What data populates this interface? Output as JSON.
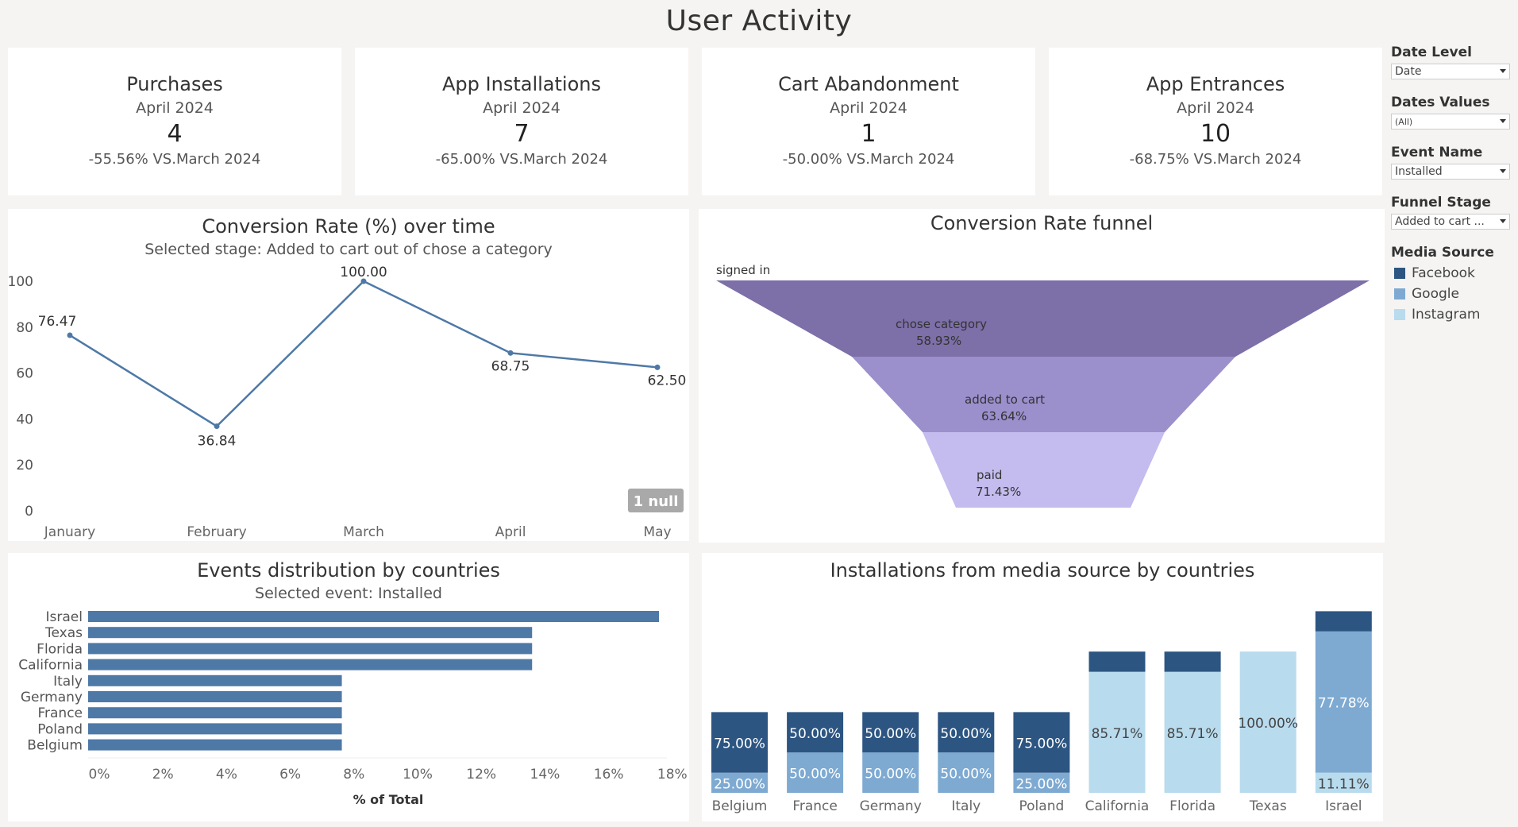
{
  "page_title": "User Activity",
  "kpis": [
    {
      "name": "Purchases",
      "period": "April 2024",
      "value": "4",
      "delta": "-55.56% VS.March 2024"
    },
    {
      "name": "App Installations",
      "period": "April 2024",
      "value": "7",
      "delta": "-65.00% VS.March 2024"
    },
    {
      "name": "Cart Abandonment",
      "period": "April 2024",
      "value": "1",
      "delta": "-50.00% VS.March 2024"
    },
    {
      "name": "App Entrances",
      "period": "April 2024",
      "value": "10",
      "delta": "-68.75% VS.March 2024"
    }
  ],
  "filters": {
    "date_level": {
      "label": "Date Level",
      "value": "Date"
    },
    "dates_values": {
      "label": "Dates Values",
      "value": "(All)"
    },
    "event_name": {
      "label": "Event Name",
      "value": "Installed"
    },
    "funnel_stage": {
      "label": "Funnel Stage",
      "value": "Added to cart ..."
    }
  },
  "legend": {
    "title": "Media Source",
    "items": [
      {
        "name": "Facebook",
        "color": "#2c5582"
      },
      {
        "name": "Google",
        "color": "#7eaad2"
      },
      {
        "name": "Instagram",
        "color": "#b8dbee"
      }
    ]
  },
  "chart_data": [
    {
      "type": "line",
      "title": "Conversion Rate (%) over time",
      "subtitle": "Selected stage: Added to cart out of chose a category",
      "categories": [
        "January",
        "February",
        "March",
        "April",
        "May"
      ],
      "values": [
        76.47,
        36.84,
        100.0,
        68.75,
        62.5
      ],
      "data_labels": [
        "76.47",
        "36.84",
        "100.00",
        "68.75",
        "62.50"
      ],
      "ylim": [
        0,
        100
      ],
      "yticks": [
        0,
        20,
        40,
        60,
        80,
        100
      ],
      "color": "#4e79a7",
      "null_badge": "1 null"
    },
    {
      "type": "funnel",
      "title": "Conversion Rate funnel",
      "stages": [
        {
          "name": "signed in",
          "pct": "",
          "color": "#7d6fa8"
        },
        {
          "name": "chose category",
          "pct": "58.93%",
          "color": "#9b8fcc"
        },
        {
          "name": "added to cart",
          "pct": "63.64%",
          "color": "#c4bbee"
        },
        {
          "name": "paid",
          "pct": "71.43%",
          "color": "#c4bbee"
        }
      ]
    },
    {
      "type": "bar",
      "orientation": "horizontal",
      "title": "Events distribution by countries",
      "subtitle": "Selected event:  Installed",
      "categories": [
        "Israel",
        "Texas",
        "Florida",
        "California",
        "Italy",
        "Germany",
        "France",
        "Poland",
        "Belgium"
      ],
      "values": [
        18,
        14,
        14,
        14,
        8,
        8,
        8,
        8,
        8
      ],
      "xlim": [
        0,
        18
      ],
      "xticks": [
        "0%",
        "2%",
        "4%",
        "6%",
        "8%",
        "10%",
        "12%",
        "14%",
        "16%",
        "18%"
      ],
      "xlabel": "% of Total",
      "color": "#4e79a7"
    },
    {
      "type": "bar",
      "orientation": "stacked",
      "title": "Installations from media source by countries",
      "categories": [
        "Belgium",
        "France",
        "Germany",
        "Italy",
        "Poland",
        "California",
        "Florida",
        "Texas",
        "Israel"
      ],
      "totals": [
        4,
        4,
        4,
        4,
        4,
        7,
        7,
        7,
        9
      ],
      "series": [
        {
          "name": "Facebook",
          "values": [
            75.0,
            50.0,
            50.0,
            50.0,
            75.0,
            14.29,
            14.29,
            0,
            11.11
          ]
        },
        {
          "name": "Google",
          "values": [
            25.0,
            50.0,
            50.0,
            50.0,
            25.0,
            0,
            0,
            0,
            77.78
          ]
        },
        {
          "name": "Instagram",
          "values": [
            0,
            0,
            0,
            0,
            0,
            85.71,
            85.71,
            100.0,
            11.11
          ]
        }
      ],
      "labels": {
        "Facebook": [
          "75.00%",
          "50.00%",
          "50.00%",
          "50.00%",
          "75.00%",
          "",
          "",
          "",
          ""
        ],
        "Google": [
          "25.00%",
          "50.00%",
          "50.00%",
          "50.00%",
          "25.00%",
          "",
          "",
          "",
          "77.78%"
        ],
        "Instagram": [
          "",
          "",
          "",
          "",
          "",
          "85.71%",
          "85.71%",
          "100.00%",
          "11.11%"
        ]
      }
    }
  ]
}
